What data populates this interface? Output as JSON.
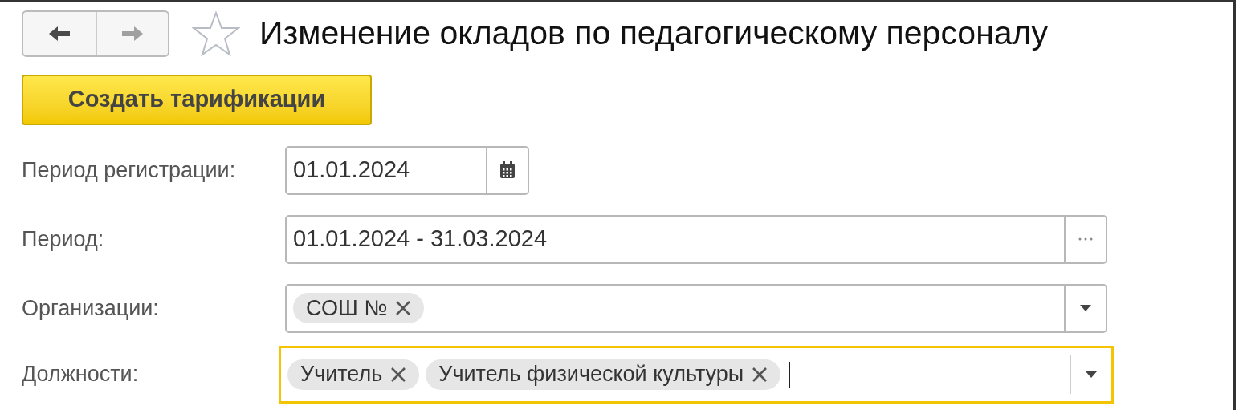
{
  "title": "Изменение окладов по педагогическому персоналу",
  "nav": {
    "back_disabled": false,
    "forward_disabled": true
  },
  "favorite": false,
  "create_button": "Создать тарификации",
  "fields": [
    {
      "kind": "date",
      "label": "Период регистрации:",
      "value": "01.01.2024",
      "focused": false
    },
    {
      "kind": "period",
      "label": "Период:",
      "value": "01.01.2024 - 31.03.2024",
      "focused": false
    },
    {
      "kind": "tags",
      "label": "Организации:",
      "tags": [
        "СОШ №"
      ],
      "focused": false
    },
    {
      "kind": "tags",
      "label": "Должности:",
      "tags": [
        "Учитель",
        "Учитель физической культуры"
      ],
      "focused": true
    }
  ]
}
